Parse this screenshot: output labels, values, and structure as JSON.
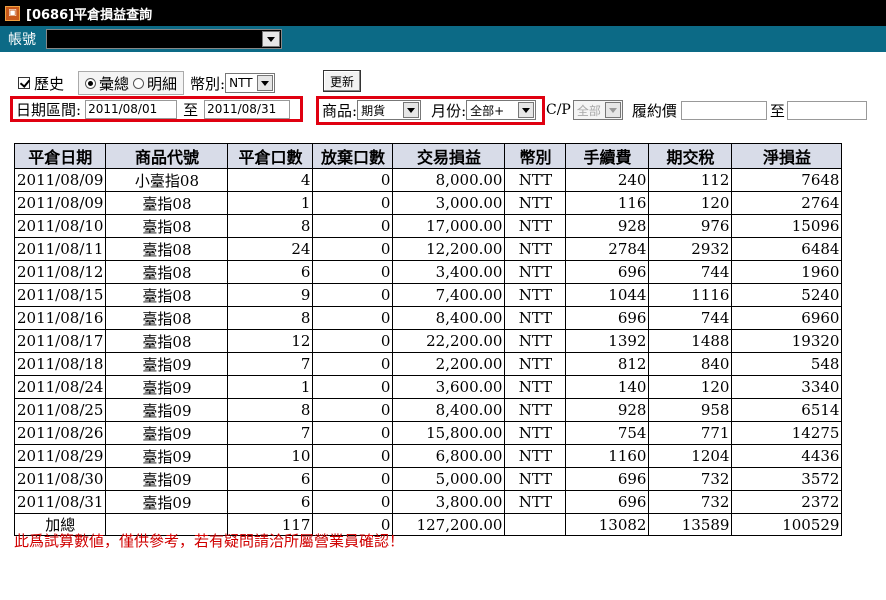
{
  "window": {
    "title": "[0686]平倉損益查詢"
  },
  "account": {
    "label": "帳號",
    "value": ""
  },
  "filters": {
    "history_label": "歷史",
    "mode_options": [
      "彙總",
      "明細"
    ],
    "currency_label": "幣別:",
    "currency_value": "NTT",
    "update_button": "更新",
    "date_range_label": "日期區間:",
    "date_from": "2011/08/01",
    "to_label": "至",
    "date_to": "2011/08/31",
    "product_label": "商品:",
    "product_value": "期貨",
    "month_label": "月份:",
    "month_value": "全部+",
    "cp_label": "C/P",
    "cp_value": "全部",
    "strike_label": "履約價",
    "strike_to_label": "至"
  },
  "table": {
    "columns": [
      "平倉日期",
      "商品代號",
      "平倉口數",
      "放棄口數",
      "交易損益",
      "幣別",
      "手續費",
      "期交稅",
      "淨損益"
    ],
    "rows": [
      [
        "2011/08/09",
        "小臺指08",
        "4",
        "0",
        "8,000.00",
        "NTT",
        "240",
        "112",
        "7648"
      ],
      [
        "2011/08/09",
        "臺指08",
        "1",
        "0",
        "3,000.00",
        "NTT",
        "116",
        "120",
        "2764"
      ],
      [
        "2011/08/10",
        "臺指08",
        "8",
        "0",
        "17,000.00",
        "NTT",
        "928",
        "976",
        "15096"
      ],
      [
        "2011/08/11",
        "臺指08",
        "24",
        "0",
        "12,200.00",
        "NTT",
        "2784",
        "2932",
        "6484"
      ],
      [
        "2011/08/12",
        "臺指08",
        "6",
        "0",
        "3,400.00",
        "NTT",
        "696",
        "744",
        "1960"
      ],
      [
        "2011/08/15",
        "臺指08",
        "9",
        "0",
        "7,400.00",
        "NTT",
        "1044",
        "1116",
        "5240"
      ],
      [
        "2011/08/16",
        "臺指08",
        "8",
        "0",
        "8,400.00",
        "NTT",
        "696",
        "744",
        "6960"
      ],
      [
        "2011/08/17",
        "臺指08",
        "12",
        "0",
        "22,200.00",
        "NTT",
        "1392",
        "1488",
        "19320"
      ],
      [
        "2011/08/18",
        "臺指09",
        "7",
        "0",
        "2,200.00",
        "NTT",
        "812",
        "840",
        "548"
      ],
      [
        "2011/08/24",
        "臺指09",
        "1",
        "0",
        "3,600.00",
        "NTT",
        "140",
        "120",
        "3340"
      ],
      [
        "2011/08/25",
        "臺指09",
        "8",
        "0",
        "8,400.00",
        "NTT",
        "928",
        "958",
        "6514"
      ],
      [
        "2011/08/26",
        "臺指09",
        "7",
        "0",
        "15,800.00",
        "NTT",
        "754",
        "771",
        "14275"
      ],
      [
        "2011/08/29",
        "臺指09",
        "10",
        "0",
        "6,800.00",
        "NTT",
        "1160",
        "1204",
        "4436"
      ],
      [
        "2011/08/30",
        "臺指09",
        "6",
        "0",
        "5,000.00",
        "NTT",
        "696",
        "732",
        "3572"
      ],
      [
        "2011/08/31",
        "臺指09",
        "6",
        "0",
        "3,800.00",
        "NTT",
        "696",
        "732",
        "2372"
      ]
    ],
    "total": [
      "加總",
      "",
      "117",
      "0",
      "127,200.00",
      "",
      "13082",
      "13589",
      "100529"
    ]
  },
  "note": "此爲試算數値，僅供參考，若有疑問請洽所屬營業員確認！",
  "colors": {
    "accent_bar": "#0c6a86",
    "highlight": "#e00010",
    "header_bg": "#d8dce8",
    "note": "#d00000"
  }
}
